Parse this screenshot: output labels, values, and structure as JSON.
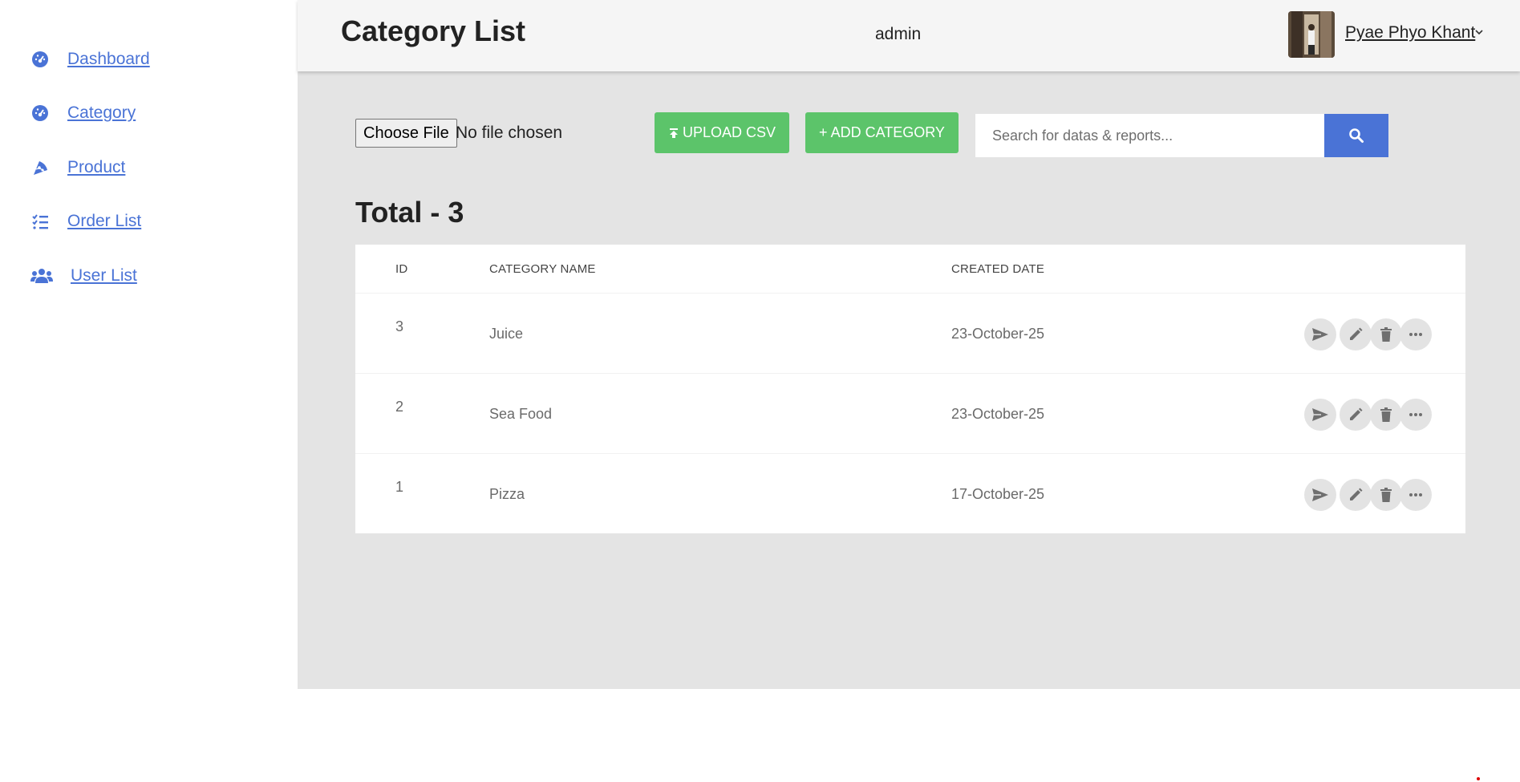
{
  "sidebar": {
    "items": [
      {
        "label": "Dashboard",
        "icon": "gauge-icon"
      },
      {
        "label": "Category",
        "icon": "gauge-icon"
      },
      {
        "label": "Product",
        "icon": "pizza-icon"
      },
      {
        "label": "Order List",
        "icon": "list-check-icon"
      },
      {
        "label": "User List",
        "icon": "users-icon"
      }
    ]
  },
  "header": {
    "title": "Category List",
    "role": "admin",
    "user_name": "Pyae Phyo Khant"
  },
  "toolbar": {
    "file_button": "Choose File",
    "file_status": "No file chosen",
    "upload_label": "UPLOAD CSV",
    "add_label": "+ ADD CATEGORY",
    "search_placeholder": "Search for datas & reports..."
  },
  "summary": {
    "total_label": "Total - 3"
  },
  "table": {
    "columns": [
      "ID",
      "CATEGORY NAME",
      "CREATED DATE"
    ],
    "rows": [
      {
        "id": "3",
        "name": "Juice",
        "date": "23-October-25"
      },
      {
        "id": "2",
        "name": "Sea Food",
        "date": "23-October-25"
      },
      {
        "id": "1",
        "name": "Pizza",
        "date": "17-October-25"
      }
    ]
  },
  "colors": {
    "accent": "#4a73d6",
    "green": "#5cc46a",
    "main_bg": "#e4e4e4"
  }
}
